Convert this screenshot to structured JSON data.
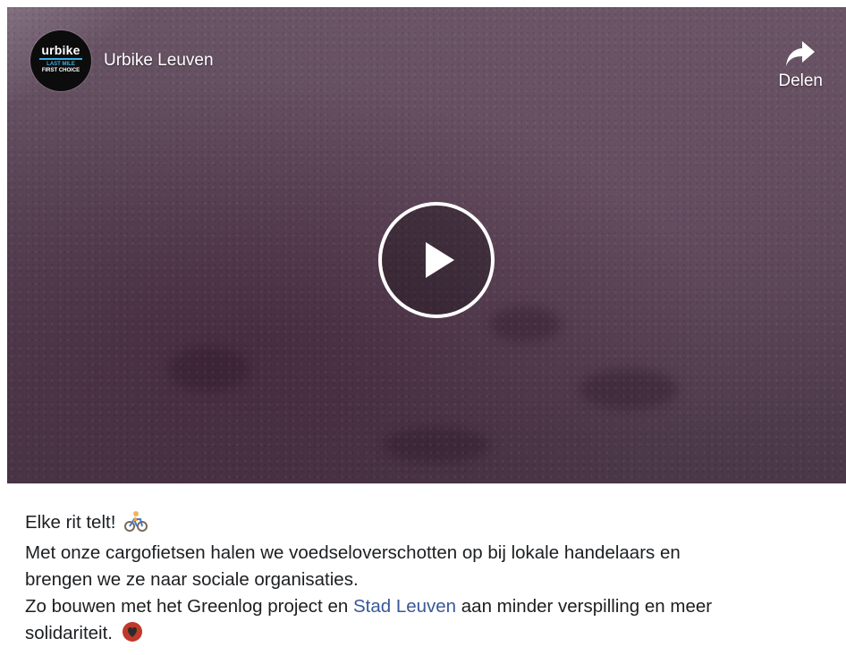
{
  "video": {
    "channel_name": "Urbike Leuven",
    "logo": {
      "word": "urbike",
      "line1": "LAST MILE",
      "line2": "FIRST CHOICE"
    },
    "share_label": "Delen",
    "play_icon": "play-icon"
  },
  "caption": {
    "line1": "Elke rit telt!",
    "line1_emoji": "bicyclist-icon",
    "line2": "Met onze cargofietsen halen we voedseloverschotten op bij lokale handelaars en",
    "line3": "brengen we ze naar sociale organisaties.",
    "line4_before": "Zo bouwen met het Greenlog project en ",
    "line4_link": "Stad Leuven",
    "line4_after": " aan minder verspilling en meer",
    "line5": "solidariteit.",
    "line5_emoji": "recycle-heart-icon"
  },
  "colors": {
    "link": "#385898",
    "text": "#1c1e21",
    "logo_accent": "#3ab0e6"
  }
}
